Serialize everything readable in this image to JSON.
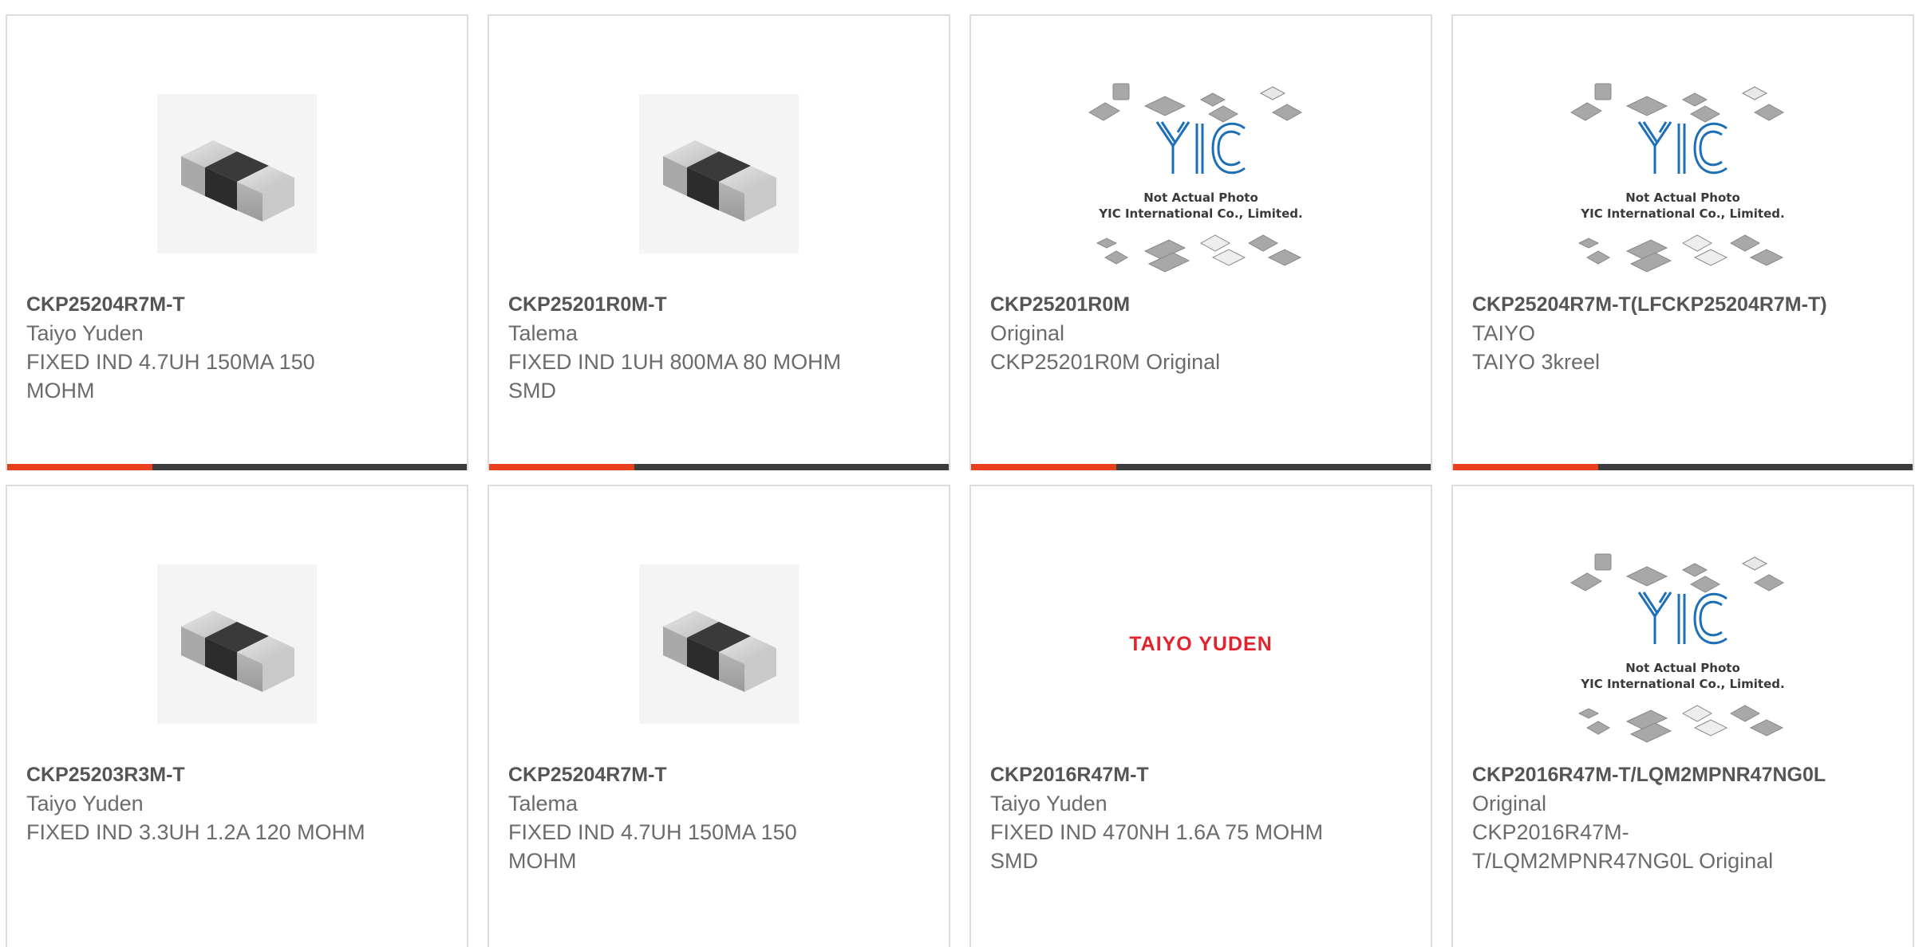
{
  "products": [
    {
      "name": "CKP25204R7M-T",
      "brand": "Taiyo Yuden",
      "description": "FIXED IND 4.7UH 150MA 150 MOHM",
      "image": "smd-inductor-photo"
    },
    {
      "name": "CKP25201R0M-T",
      "brand": "Talema",
      "description": "FIXED IND 1UH 800MA 80 MOHM SMD",
      "image": "smd-inductor-photo"
    },
    {
      "name": "CKP25201R0M",
      "brand": "Original",
      "description": "CKP25201R0M Original",
      "image": "yic-placeholder",
      "image_caption_1": "Not Actual Photo",
      "image_caption_2": "YIC International Co., Limited."
    },
    {
      "name": "CKP25204R7M-T(LFCKP25204R7M-T)",
      "brand": "TAIYO",
      "description": "TAIYO 3kreel",
      "image": "yic-placeholder",
      "image_caption_1": "Not Actual Photo",
      "image_caption_2": "YIC International Co., Limited."
    },
    {
      "name": "CKP25203R3M-T",
      "brand": "Taiyo Yuden",
      "description": "FIXED IND 3.3UH 1.2A 120 MOHM",
      "image": "smd-inductor-photo"
    },
    {
      "name": "CKP25204R7M-T",
      "brand": "Talema",
      "description": "FIXED IND 4.7UH 150MA 150 MOHM",
      "image": "smd-inductor-photo"
    },
    {
      "name": "CKP2016R47M-T",
      "brand": "Taiyo Yuden",
      "description": "FIXED IND 470NH 1.6A 75 MOHM SMD",
      "image": "brand-logo",
      "logo_text": "TAIYO YUDEN"
    },
    {
      "name": "CKP2016R47M-T/LQM2MPNR47NG0L",
      "brand": "Original",
      "description": "CKP2016R47M-T/LQM2MPNR47NG0L Original",
      "image": "yic-placeholder",
      "image_caption_1": "Not Actual Photo",
      "image_caption_2": "YIC International Co., Limited."
    }
  ],
  "colors": {
    "accent": "#e8401c",
    "bar_dark": "#3c3c3c",
    "logo_red": "#e4222c",
    "yic_blue": "#1d6fb8"
  }
}
